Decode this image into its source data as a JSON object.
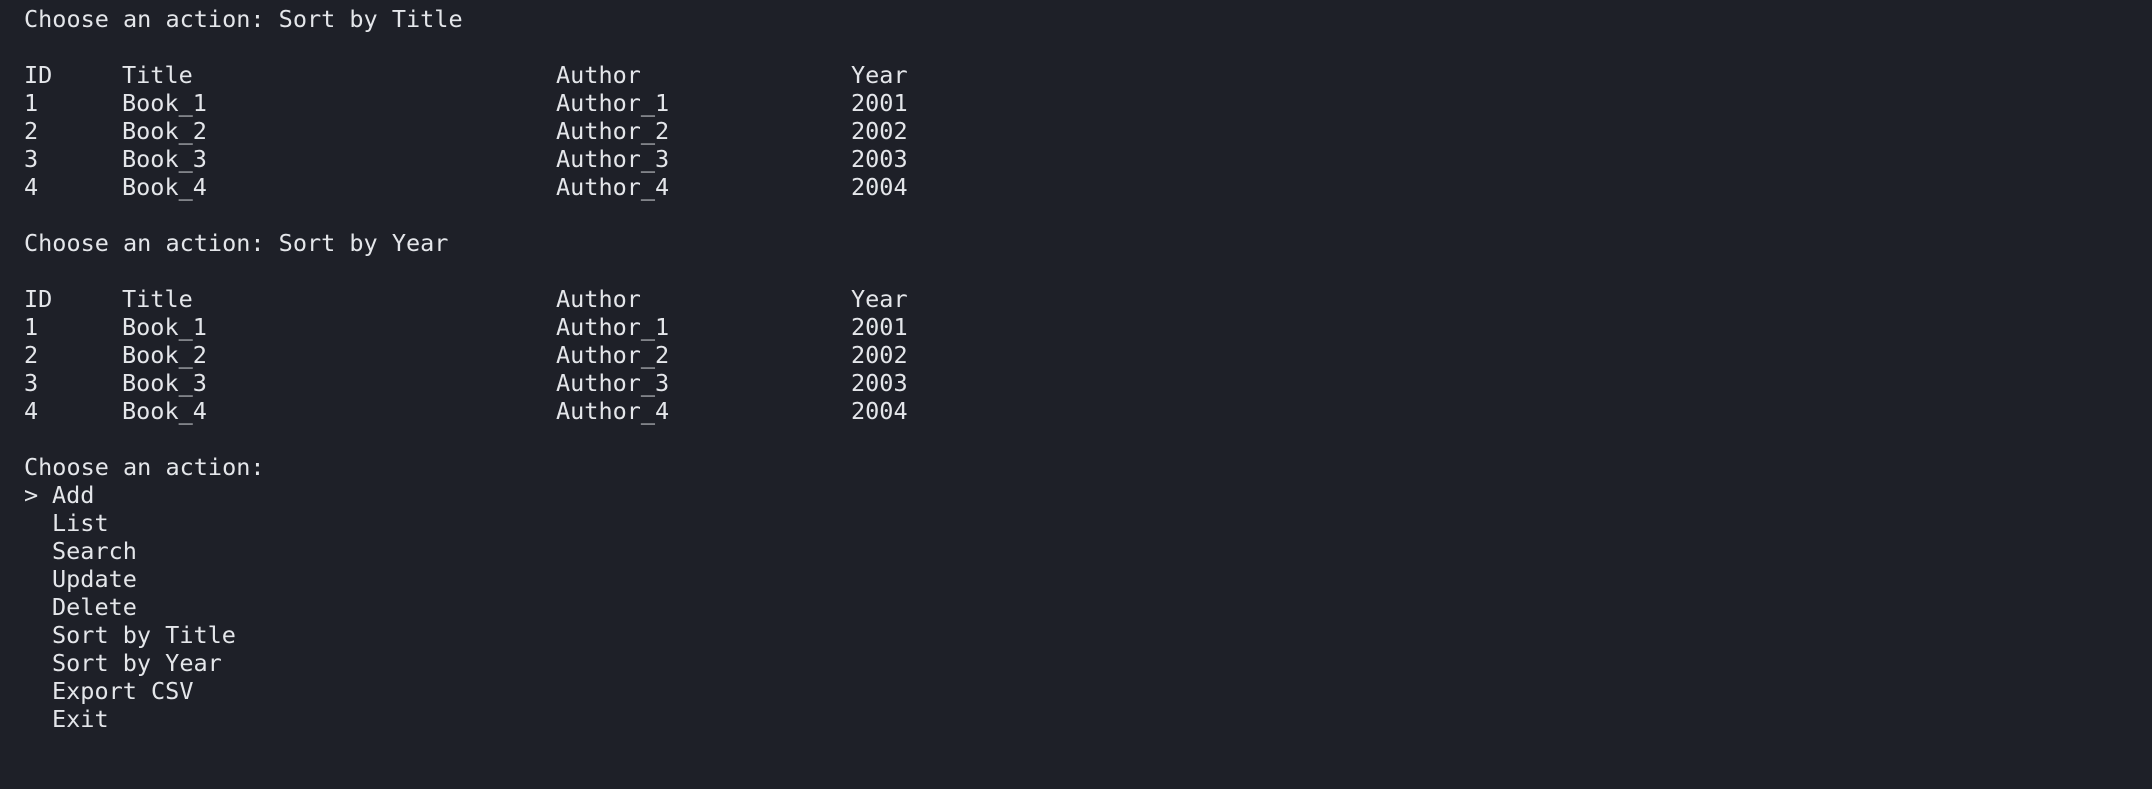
{
  "blocks": [
    {
      "prompt": "Choose an action: Sort by Title",
      "headers": [
        "ID",
        "Title",
        "Author",
        "Year"
      ],
      "rows": [
        [
          "1",
          "Book_1",
          "Author_1",
          "2001"
        ],
        [
          "2",
          "Book_2",
          "Author_2",
          "2002"
        ],
        [
          "3",
          "Book_3",
          "Author_3",
          "2003"
        ],
        [
          "4",
          "Book_4",
          "Author_4",
          "2004"
        ]
      ]
    },
    {
      "prompt": "Choose an action: Sort by Year",
      "headers": [
        "ID",
        "Title",
        "Author",
        "Year"
      ],
      "rows": [
        [
          "1",
          "Book_1",
          "Author_1",
          "2001"
        ],
        [
          "2",
          "Book_2",
          "Author_2",
          "2002"
        ],
        [
          "3",
          "Book_3",
          "Author_3",
          "2003"
        ],
        [
          "4",
          "Book_4",
          "Author_4",
          "2004"
        ]
      ]
    }
  ],
  "menu": {
    "prompt": "Choose an action:",
    "cursor": ">",
    "selected_index": 0,
    "items": [
      "Add",
      "List",
      "Search",
      "Update",
      "Delete",
      "Sort by Title",
      "Sort by Year",
      "Export CSV",
      "Exit"
    ]
  },
  "colors": {
    "background": "#1e2028",
    "foreground": "#e4e6ea"
  }
}
